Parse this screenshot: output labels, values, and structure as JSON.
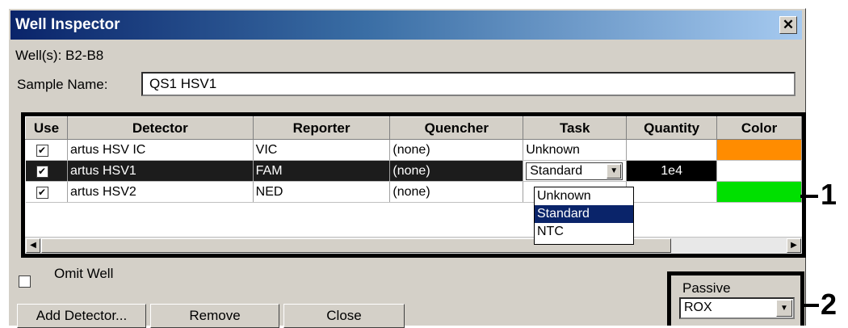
{
  "window": {
    "title": "Well Inspector",
    "close_glyph": "✕"
  },
  "wells_label": "Well(s): B2-B8",
  "sample": {
    "label": "Sample Name:",
    "value": "QS1 HSV1"
  },
  "table": {
    "columns": [
      "Use",
      "Detector",
      "Reporter",
      "Quencher",
      "Task",
      "Quantity",
      "Color"
    ],
    "rows": [
      {
        "use": true,
        "detector": "artus HSV IC",
        "reporter": "VIC",
        "quencher": "(none)",
        "task": "Unknown",
        "quantity": "",
        "color": "#ff8c00"
      },
      {
        "use": true,
        "detector": "artus HSV1",
        "reporter": "FAM",
        "quencher": "(none)",
        "task": "Standard",
        "quantity": "1e4",
        "color": "#ffffff"
      },
      {
        "use": true,
        "detector": "artus HSV2",
        "reporter": "NED",
        "quencher": "(none)",
        "task": "",
        "quantity": "",
        "color": "#00e000"
      }
    ],
    "task_options": [
      "Unknown",
      "Standard",
      "NTC"
    ],
    "task_highlighted": "Standard"
  },
  "omit_well_label": "Omit Well",
  "buttons": {
    "add_detector": "Add Detector...",
    "remove": "Remove",
    "close": "Close"
  },
  "passive": {
    "label": "Passive",
    "value": "ROX"
  },
  "callouts": {
    "one": "1",
    "two": "2"
  },
  "icons": {
    "checkbox_checked": "check-icon",
    "dropdown_arrow": "chevron-down-icon",
    "scroll_left": "chevron-left-icon",
    "scroll_right": "chevron-right-icon"
  }
}
